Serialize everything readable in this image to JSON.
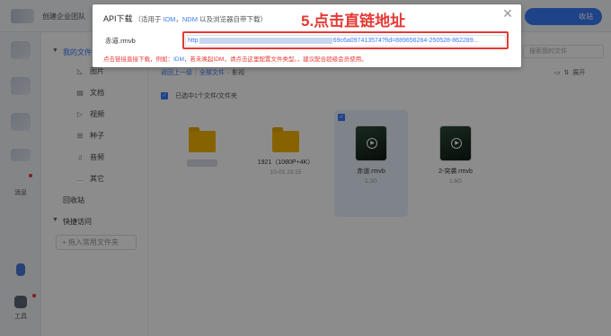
{
  "topbar": {
    "team_name": "创建企业团队",
    "top_right_btn": "收站"
  },
  "rail": {
    "messages_label": "消息",
    "tools_label": "工具"
  },
  "sidebar": {
    "my_files": "我的文件",
    "items": [
      {
        "icon": "image-icon",
        "glyph": "◺",
        "label": "图片"
      },
      {
        "icon": "document-icon",
        "glyph": "▤",
        "label": "文档"
      },
      {
        "icon": "video-icon",
        "glyph": "▷",
        "label": "视频"
      },
      {
        "icon": "seed-icon",
        "glyph": "⊞",
        "label": "种子"
      },
      {
        "icon": "music-icon",
        "glyph": "♫",
        "label": "音频"
      },
      {
        "icon": "more-icon",
        "glyph": "…",
        "label": "其它"
      }
    ],
    "recycle": "回收站",
    "quick_access": "快捷访问",
    "add_common": "+ 拖入常用文件夹"
  },
  "main": {
    "search_placeholder": "搜索我的文件",
    "breadcrumb": {
      "back": "返回上一级",
      "all": "全部文件",
      "current": "影视"
    },
    "view_tools": "展开",
    "selection_text": "已选中1个文件/文件夹",
    "files": [
      {
        "name": "1921（1080P+4K）",
        "meta": "10-03 23:15",
        "type": "folder"
      },
      {
        "name": "赤道.rmvb",
        "meta": "1.3G",
        "type": "video"
      },
      {
        "name": "2-突袭.rmvb",
        "meta": "1.6G",
        "type": "video"
      }
    ]
  },
  "dialog": {
    "title": "API下载",
    "subtitle_prefix": "（适用于",
    "idm": "IDM",
    "ndm": "NDM",
    "subtitle_suffix": "以及浏览器自带下载）",
    "close": "✕",
    "file_name": "赤道.rmvb",
    "url_prefix": "http",
    "url_suffix": "69c6a097413574?fid=889656284-250528-862289...",
    "tip_prefix": "点击链接直接下载，例如：",
    "tip_idm": "IDM",
    "tip_middle": "，若未唤起IDM，请点击这里配置文件类型。",
    "tip_suffix": "，建议配合超级会员使用。"
  },
  "annotation": {
    "step": "5.点击直链地址"
  },
  "colors": {
    "accent": "#3a7bf7",
    "annotation": "#e53935",
    "folder": "#f4b400"
  }
}
